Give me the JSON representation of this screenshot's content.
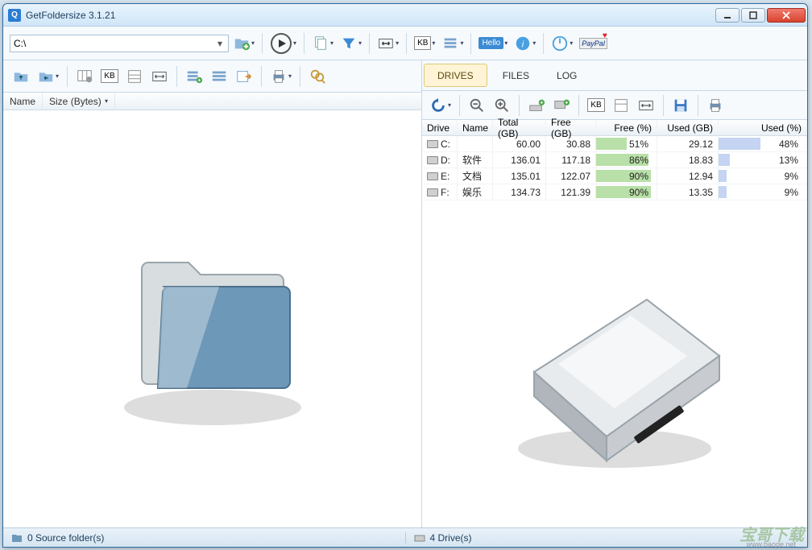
{
  "app_title": "GetFoldersize 3.1.21",
  "path_value": "C:\\",
  "tabs": {
    "drives": "DRIVES",
    "files": "FILES",
    "log": "LOG"
  },
  "left_cols": {
    "name": "Name",
    "size": "Size (Bytes)"
  },
  "drive_cols": {
    "drive": "Drive",
    "name": "Name",
    "total": "Total (GB)",
    "free": "Free (GB)",
    "freep": "Free (%)",
    "used": "Used (GB)",
    "usedp": "Used (%)"
  },
  "drives": [
    {
      "drive": "C:",
      "name": "",
      "total": "60.00",
      "free": "30.88",
      "freep": "51%",
      "freep_v": 51,
      "used": "29.12",
      "usedp": "48%",
      "usedp_v": 48
    },
    {
      "drive": "D:",
      "name": "软件",
      "total": "136.01",
      "free": "117.18",
      "freep": "86%",
      "freep_v": 86,
      "used": "18.83",
      "usedp": "13%",
      "usedp_v": 13
    },
    {
      "drive": "E:",
      "name": "文档",
      "total": "135.01",
      "free": "122.07",
      "freep": "90%",
      "freep_v": 90,
      "used": "12.94",
      "usedp": "9%",
      "usedp_v": 9
    },
    {
      "drive": "F:",
      "name": "娱乐",
      "total": "134.73",
      "free": "121.39",
      "freep": "90%",
      "freep_v": 90,
      "used": "13.35",
      "usedp": "9%",
      "usedp_v": 9
    }
  ],
  "status": {
    "left": "0 Source folder(s)",
    "right": "4 Drive(s)"
  },
  "icons": {
    "hello": "Hello",
    "kb": "KB",
    "paypal": "PayPal"
  },
  "chart_data": {
    "type": "table",
    "title": "Drive usage",
    "columns": [
      "Drive",
      "Name",
      "Total (GB)",
      "Free (GB)",
      "Free (%)",
      "Used (GB)",
      "Used (%)"
    ],
    "rows": [
      [
        "C:",
        "",
        60.0,
        30.88,
        51,
        29.12,
        48
      ],
      [
        "D:",
        "软件",
        136.01,
        117.18,
        86,
        18.83,
        13
      ],
      [
        "E:",
        "文档",
        135.01,
        122.07,
        90,
        12.94,
        9
      ],
      [
        "F:",
        "娱乐",
        134.73,
        121.39,
        90,
        13.35,
        9
      ]
    ]
  }
}
